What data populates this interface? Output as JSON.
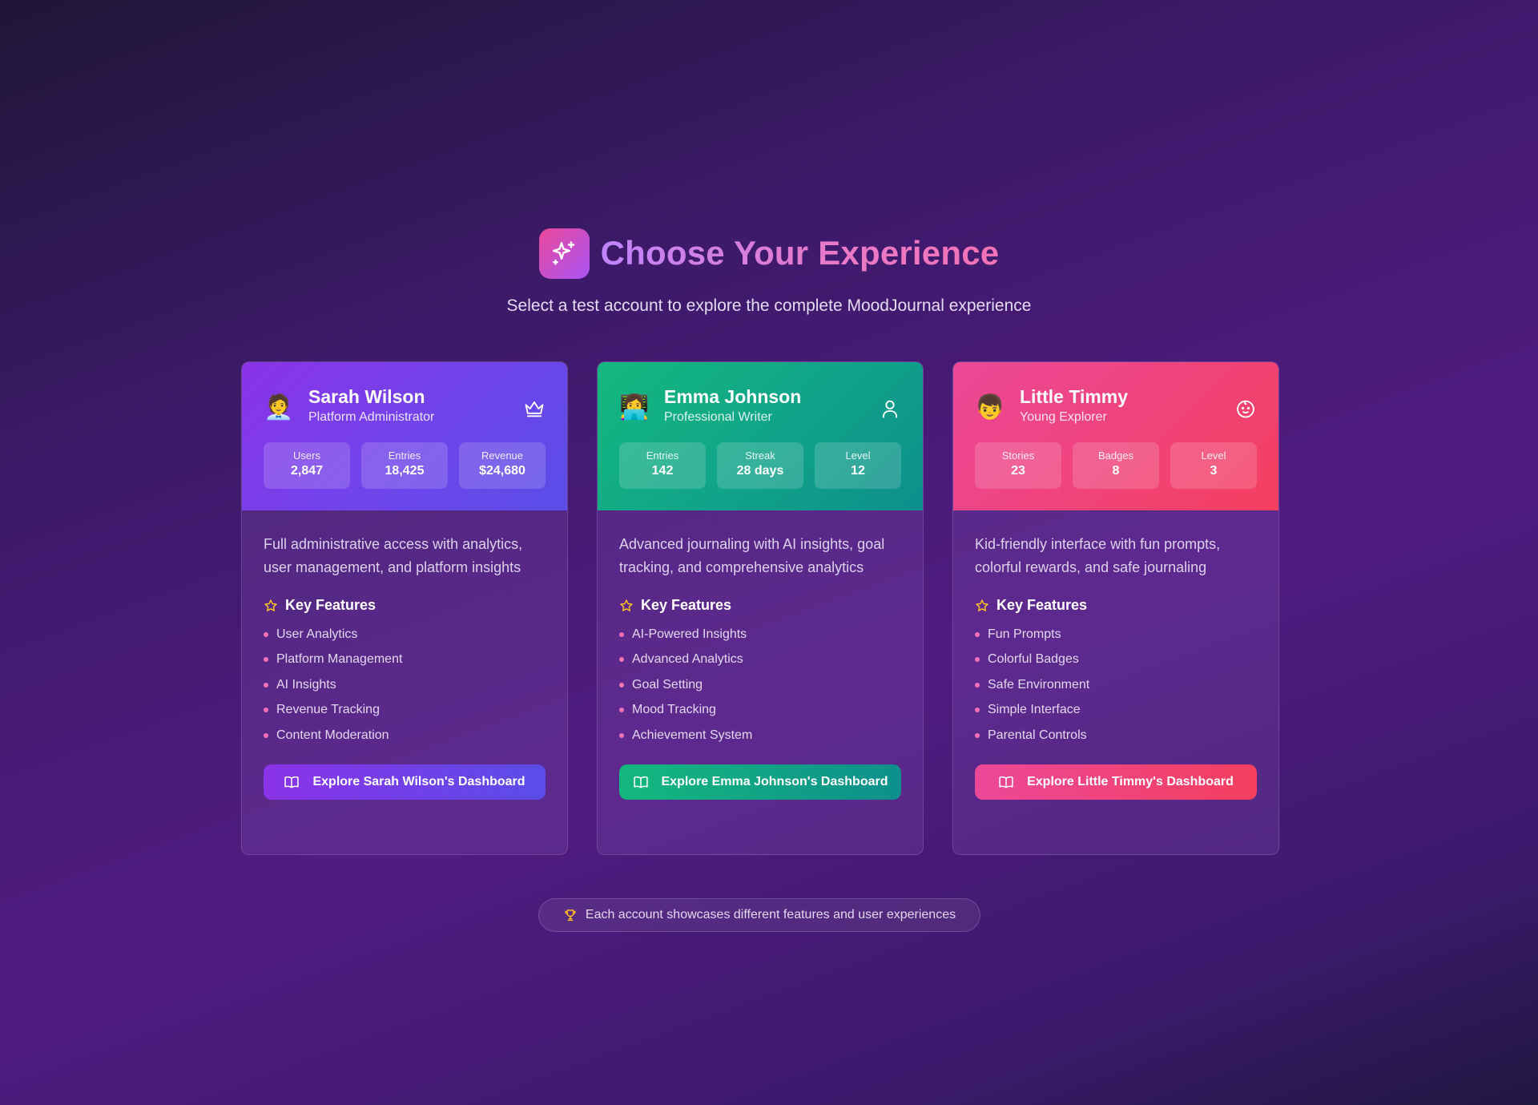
{
  "header": {
    "title": "Choose Your Experience",
    "subtitle": "Select a test account to explore the complete MoodJournal experience"
  },
  "accounts": [
    {
      "name": "Sarah Wilson",
      "role": "Platform Administrator",
      "avatar": "🧑‍💼",
      "role_icon": "crown-icon",
      "stats": [
        {
          "label": "Users",
          "value": "2,847"
        },
        {
          "label": "Entries",
          "value": "18,425"
        },
        {
          "label": "Revenue",
          "value": "$24,680"
        }
      ],
      "description": "Full administrative access with analytics, user management, and platform insights",
      "features_title": "Key Features",
      "features": [
        "User Analytics",
        "Platform Management",
        "AI Insights",
        "Revenue Tracking",
        "Content Moderation"
      ],
      "cta": "Explore Sarah Wilson's Dashboard"
    },
    {
      "name": "Emma Johnson",
      "role": "Professional Writer",
      "avatar": "👩‍💻",
      "role_icon": "user-icon",
      "stats": [
        {
          "label": "Entries",
          "value": "142"
        },
        {
          "label": "Streak",
          "value": "28 days"
        },
        {
          "label": "Level",
          "value": "12"
        }
      ],
      "description": "Advanced journaling with AI insights, goal tracking, and comprehensive analytics",
      "features_title": "Key Features",
      "features": [
        "AI-Powered Insights",
        "Advanced Analytics",
        "Goal Setting",
        "Mood Tracking",
        "Achievement System"
      ],
      "cta": "Explore Emma Johnson's Dashboard"
    },
    {
      "name": "Little Timmy",
      "role": "Young Explorer",
      "avatar": "👦",
      "role_icon": "baby-icon",
      "stats": [
        {
          "label": "Stories",
          "value": "23"
        },
        {
          "label": "Badges",
          "value": "8"
        },
        {
          "label": "Level",
          "value": "3"
        }
      ],
      "description": "Kid-friendly interface with fun prompts, colorful rewards, and safe journaling",
      "features_title": "Key Features",
      "features": [
        "Fun Prompts",
        "Colorful Badges",
        "Safe Environment",
        "Simple Interface",
        "Parental Controls"
      ],
      "cta": "Explore Little Timmy's Dashboard"
    }
  ],
  "footer": {
    "note": "Each account showcases different features and user experiences",
    "icon": "trophy-icon"
  },
  "colors": {
    "admin": "#7c3aed",
    "writer": "#10b981",
    "kid": "#ec4899",
    "bullet": "#f472b6",
    "star": "#fbbf24"
  }
}
